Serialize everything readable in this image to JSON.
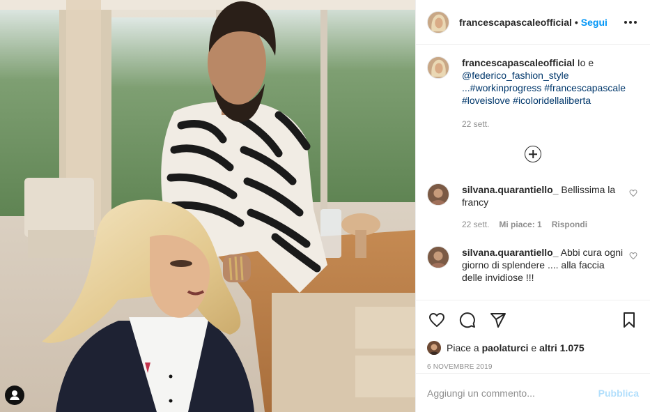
{
  "photo": {
    "icons": [
      "user-tag-icon"
    ]
  },
  "header": {
    "username": "francescapascaleofficial",
    "dot": "•",
    "follow_label": "Segui",
    "more_icon": "more-options-icon"
  },
  "caption": {
    "username": "francescapascaleofficial",
    "text_prefix": "Io e",
    "mention": "@federico_fashion_style",
    "text_lines": [
      "...#workinprogress #francescapascale",
      "#loveislove #icoloridellaliberta"
    ],
    "time": "22 sett."
  },
  "load_more_icon": "plus-circle-icon",
  "comments": [
    {
      "username": "silvana.quarantiello_",
      "text": "Bellissima la francy",
      "time": "22 sett.",
      "likes": "Mi piace: 1",
      "reply": "Rispondi"
    },
    {
      "username": "silvana.quarantiello_",
      "text": "Abbi cura ogni giorno di splendere .... alla faccia delle invidiose !!!"
    }
  ],
  "actions": {
    "icons": [
      "heart-icon",
      "comment-icon",
      "share-icon",
      "bookmark-icon"
    ]
  },
  "likes": {
    "prefix": "Piace a",
    "user": "paolaturci",
    "and": "e",
    "others": "altri 1.075"
  },
  "date": "6 NOVEMBRE 2019",
  "add_comment": {
    "placeholder": "Aggiungi un commento...",
    "publish_label": "Pubblica"
  },
  "colors": {
    "link_blue": "#0095f6",
    "publish_disabled": "#b2dffc",
    "meta_gray": "#8e8e8e",
    "text": "#262626"
  }
}
